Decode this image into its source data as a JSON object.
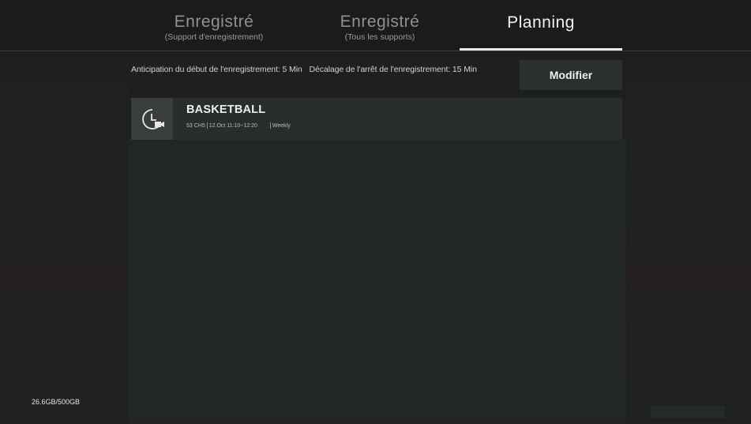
{
  "tabs": [
    {
      "title": "Enregistré",
      "subtitle": "(Support d'enregistrement)"
    },
    {
      "title": "Enregistré",
      "subtitle": "(Tous les supports)"
    },
    {
      "title": "Planning",
      "subtitle": ""
    }
  ],
  "active_tab": "Planning",
  "info": {
    "start_anticipation": "Anticipation du début de l'enregistrement: 5 Min",
    "stop_delay": "Décalage de l'arrêt de l'enregistrement: 15 Min"
  },
  "modify_button": "Modifier",
  "recordings": [
    {
      "icon": "clock-record-icon",
      "title": "BASKETBALL",
      "channel": "53 CH5",
      "schedule": "12.Oct 11:10~12:20",
      "repeat": "Weekly"
    }
  ],
  "storage": "26.6GB/500GB",
  "colors": {
    "background": "#1e2021",
    "row": "#2a2d2e",
    "active_underline": "#e9e9e9",
    "button": "#2c2f30"
  }
}
